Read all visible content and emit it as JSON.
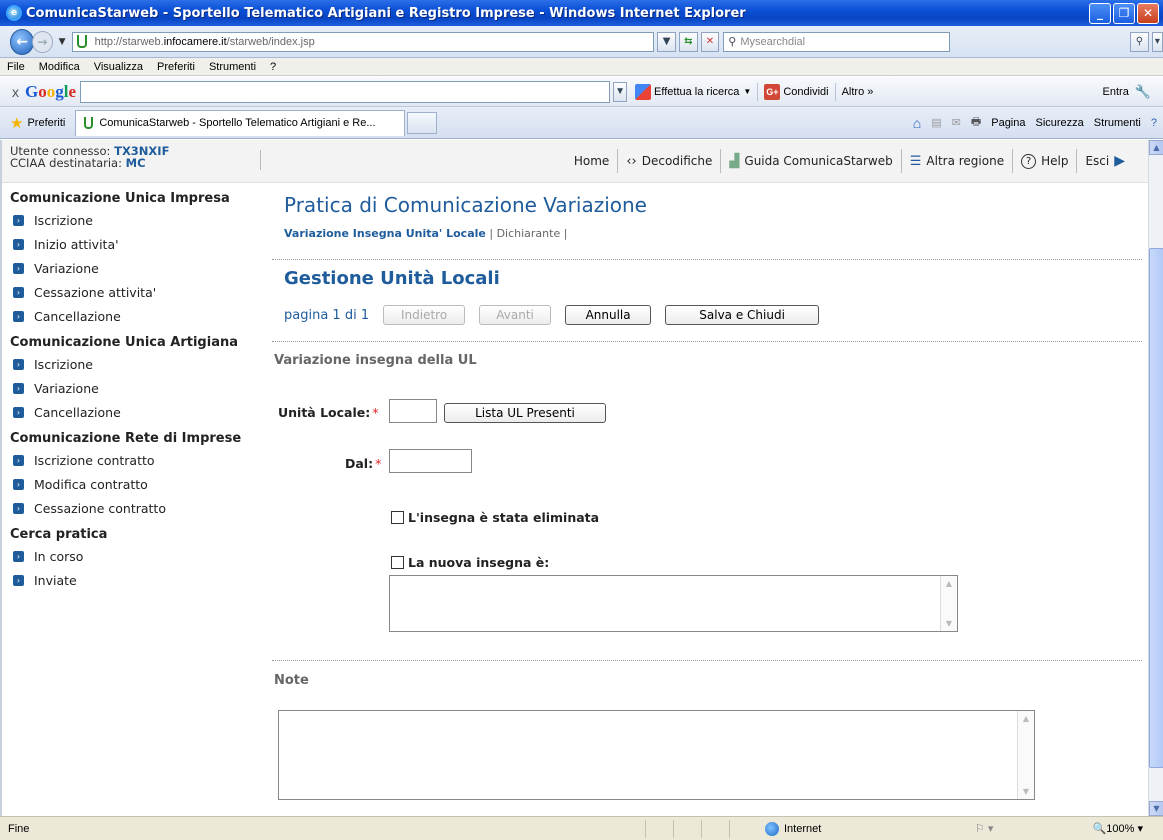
{
  "window": {
    "title": "ComunicaStarweb - Sportello Telematico Artigiani e Registro Imprese - Windows Internet Explorer"
  },
  "address": {
    "url_prefix": "http://starweb.",
    "url_host": "infocamere.it",
    "url_suffix": "/starweb/index.jsp",
    "search_placeholder": "Mysearchdial"
  },
  "menu": [
    "File",
    "Modifica",
    "Visualizza",
    "Preferiti",
    "Strumenti",
    "?"
  ],
  "google_toolbar": {
    "logo": "Google",
    "search_label": "Effettua la ricerca",
    "share_label": "Condividi",
    "more_label": "Altro »",
    "signin_label": "Entra"
  },
  "tabs": {
    "favorites_label": "Preferiti",
    "active_tab": "ComunicaStarweb - Sportello Telematico Artigiani e Re...",
    "commands": [
      "Pagina",
      "Sicurezza",
      "Strumenti"
    ]
  },
  "header": {
    "user_label": "Utente connesso:",
    "user_value": "TX3NXIF",
    "cciaa_label": "CCIAA destinataria:",
    "cciaa_value": "MC",
    "nav": {
      "home": "Home",
      "decodifiche": "Decodifiche",
      "guida": "Guida ComunicaStarweb",
      "regione": "Altra regione",
      "help": "Help",
      "esci": "Esci"
    }
  },
  "sidebar": {
    "sections": [
      {
        "title": "Comunicazione Unica Impresa",
        "items": [
          "Iscrizione",
          "Inizio attivita'",
          "Variazione",
          "Cessazione attivita'",
          "Cancellazione"
        ]
      },
      {
        "title": "Comunicazione Unica Artigiana",
        "items": [
          "Iscrizione",
          "Variazione",
          "Cancellazione"
        ]
      },
      {
        "title": "Comunicazione Rete di Imprese",
        "items": [
          "Iscrizione contratto",
          "Modifica contratto",
          "Cessazione contratto"
        ]
      },
      {
        "title": "Cerca pratica",
        "items": [
          "In corso",
          "Inviate"
        ]
      }
    ]
  },
  "main": {
    "title": "Pratica di Comunicazione Variazione",
    "breadcrumb_active": "Variazione Insegna Unita' Locale",
    "breadcrumb_other": "Dichiarante",
    "subtitle": "Gestione Unità Locali",
    "pager_text": "pagina 1 di 1",
    "btn_back": "Indietro",
    "btn_next": "Avanti",
    "btn_cancel": "Annulla",
    "btn_save": "Salva e Chiudi",
    "section_label": "Variazione insegna della UL",
    "unita_label": "Unità Locale:",
    "unita_value": "",
    "lista_btn": "Lista UL Presenti",
    "dal_label": "Dal:",
    "dal_value": "",
    "check_eliminata": "L'insegna è stata eliminata",
    "check_nuova": "La nuova insegna è:",
    "nuova_value": "",
    "note_label": "Note",
    "note_value": ""
  },
  "statusbar": {
    "status": "Fine",
    "zone": "Internet",
    "zoom": "100%"
  }
}
